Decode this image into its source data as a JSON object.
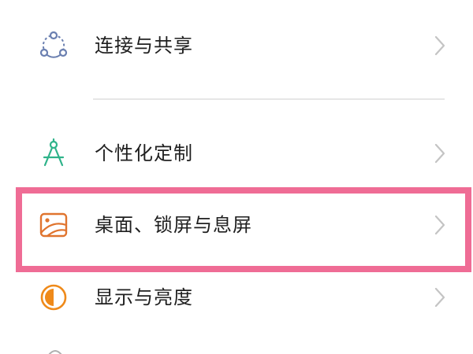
{
  "settings": {
    "items": [
      {
        "label": "连接与共享",
        "icon": "connection-share-icon"
      },
      {
        "label": "个性化定制",
        "icon": "personalization-icon"
      },
      {
        "label": "桌面、锁屏与息屏",
        "icon": "wallpaper-icon"
      },
      {
        "label": "显示与亮度",
        "icon": "display-brightness-icon"
      }
    ]
  },
  "colors": {
    "highlight_border": "#ef6c95",
    "connection_icon": "#6a7fb0",
    "personalization_icon": "#2fb38a",
    "wallpaper_icon": "#e0742e",
    "display_icon": "#ef8a1a",
    "chevron": "#c4c4c4",
    "divider": "#e6e6e6"
  }
}
